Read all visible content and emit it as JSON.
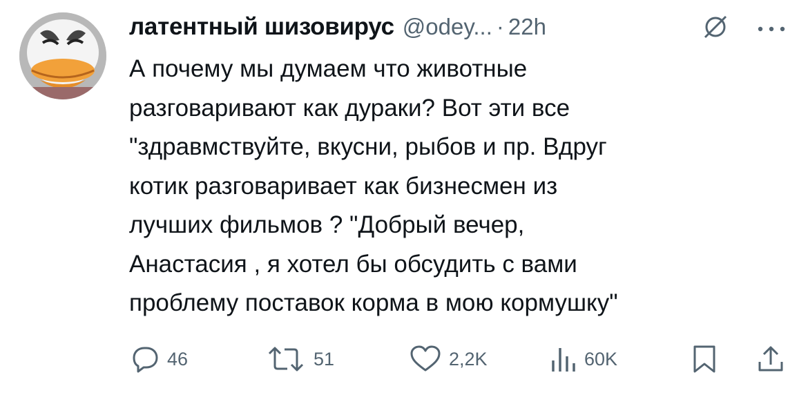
{
  "tweet": {
    "display_name": "латентный шизовирус",
    "handle": "@odey...",
    "separator": "·",
    "time": "22h",
    "lines": [
      "А почему мы думаем что животные",
      "разговаривают как дураки? Вот эти все",
      "\"здравмствуйте, вкусни,  рыбов и пр. Вдруг",
      "котик разговаривает как бизнесмен из",
      "лучших фильмов ? \"Добрый вечер,",
      "Анастасия , я хотел бы обсудить с вами",
      "проблему поставок корма в мою кормушку\""
    ]
  },
  "actions": {
    "replies": "46",
    "reposts": "51",
    "likes": "2,2K",
    "views": "60K"
  },
  "icons": {
    "avatar": "duck-avatar",
    "grok": "grok-icon",
    "more": "more-icon",
    "reply": "reply-icon",
    "repost": "repost-icon",
    "like": "heart-icon",
    "views": "views-icon",
    "bookmark": "bookmark-icon",
    "share": "share-icon"
  },
  "colors": {
    "text": "#0f1419",
    "secondary": "#536471"
  }
}
